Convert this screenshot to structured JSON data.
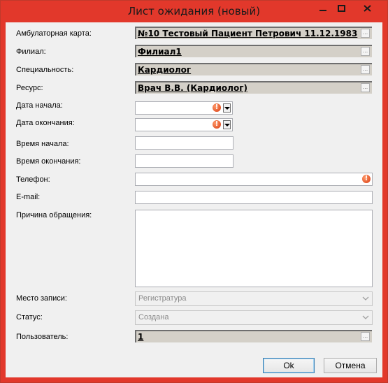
{
  "window": {
    "title": "Лист ожидания (новый)"
  },
  "fields": {
    "card": {
      "label": "Амбулаторная карта:",
      "value": "№10 Тестовый Пациент Петрович 11.12.1983"
    },
    "branch": {
      "label": "Филиал:",
      "value": "Филиал1"
    },
    "specialty": {
      "label": "Специальность:",
      "value": "Кардиолог"
    },
    "resource": {
      "label": "Ресурс:",
      "value": "Врач В.В. (Кардиолог)"
    },
    "date_start": {
      "label": "Дата начала:",
      "value": ""
    },
    "date_end": {
      "label": "Дата окончания:",
      "value": ""
    },
    "time_start": {
      "label": "Время начала:",
      "value": ""
    },
    "time_end": {
      "label": "Время окончания:",
      "value": ""
    },
    "phone": {
      "label": "Телефон:",
      "value": ""
    },
    "email": {
      "label": "E-mail:",
      "value": ""
    },
    "reason": {
      "label": "Причина обращения:",
      "value": ""
    },
    "place": {
      "label": "Место записи:",
      "value": "Регистратура"
    },
    "status": {
      "label": "Статус:",
      "value": "Создана"
    },
    "user": {
      "label": "Пользователь:",
      "value": "1"
    }
  },
  "buttons": {
    "ok": "Ok",
    "cancel": "Отмена",
    "ellipsis": "..."
  },
  "icons": {
    "error": "error-icon",
    "dropdown": "dropdown-arrow-icon",
    "minimize": "minimize-icon",
    "maximize": "maximize-icon",
    "close": "close-icon"
  },
  "colors": {
    "titlebar": "#e2382b",
    "client": "#f0f0f0",
    "readonly": "#d4d0c8",
    "error": "#d83a10"
  }
}
